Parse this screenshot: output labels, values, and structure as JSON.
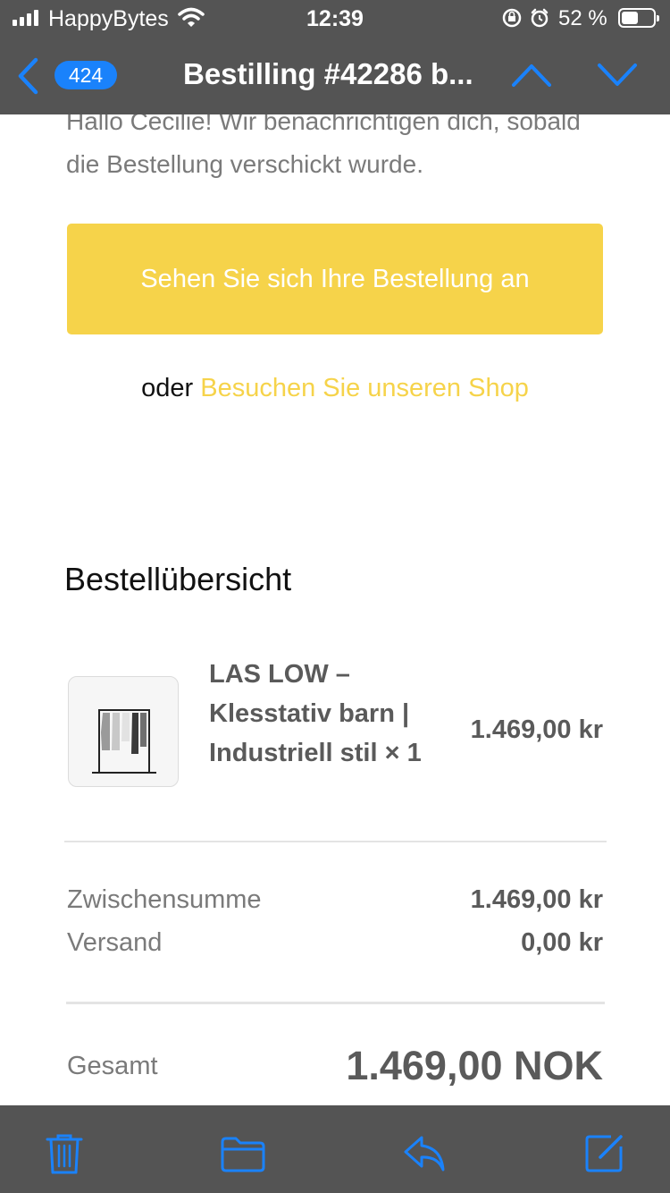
{
  "status_bar": {
    "carrier": "HappyBytes",
    "time": "12:39",
    "battery_percent": "52 %",
    "battery_level": 0.52
  },
  "nav": {
    "unread_count": "424",
    "title": "Bestilling #42286 b..."
  },
  "email": {
    "greeting": "Hallo Cecilie! Wir benachrichtigen dich, sobald die Bestellung verschickt wurde.",
    "cta_label": "Sehen Sie sich Ihre Bestellung an",
    "or_text": "oder",
    "shop_link": "Besuchen Sie unseren Shop",
    "summary_title": "Bestellübersicht",
    "product": {
      "name": "LAS LOW – Klesstativ barn | Industriell stil × 1",
      "price": "1.469,00 kr"
    },
    "subtotal_label": "Zwischensumme",
    "subtotal_value": "1.469,00 kr",
    "shipping_label": "Versand",
    "shipping_value": "0,00 kr",
    "total_label": "Gesamt",
    "total_value": "1.469,00 NOK"
  },
  "colors": {
    "accent": "#f6d34a",
    "ios_blue": "#1a82fb",
    "bar_gray": "#545454"
  },
  "icons": [
    "back-chevron-icon",
    "up-arrow-icon",
    "down-arrow-icon",
    "trash-icon",
    "folder-icon",
    "reply-icon",
    "compose-icon"
  ]
}
